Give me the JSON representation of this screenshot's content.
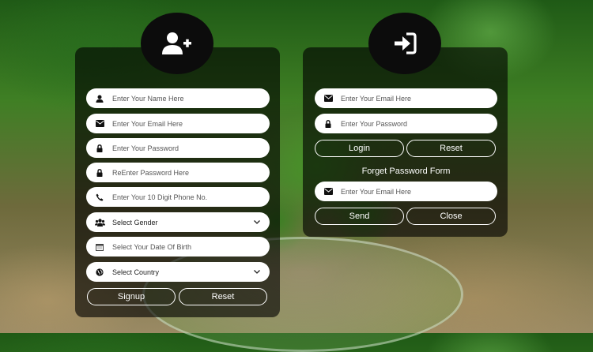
{
  "signup": {
    "name_placeholder": "Enter Your Name Here",
    "email_placeholder": "Enter Your Email Here",
    "password_placeholder": "Enter Your Password",
    "reenter_password_placeholder": "ReEnter Password Here",
    "phone_placeholder": "Enter Your 10 Digit Phone No.",
    "gender_select": "Select Gender",
    "dob_placeholder": "Select Your Date Of Birth",
    "country_select": "Select Country",
    "signup_label": "Signup",
    "reset_label": "Reset"
  },
  "login": {
    "email_placeholder": "Enter Your Email Here",
    "password_placeholder": "Enter Your Password",
    "login_label": "Login",
    "reset_label": "Reset"
  },
  "forget": {
    "title": "Forget Password Form",
    "email_placeholder": "Enter Your Email Here",
    "send_label": "Send",
    "close_label": "Close"
  },
  "icons": {
    "signup_header": "add-user-icon",
    "login_header": "sign-in-icon",
    "name": "user-icon",
    "email": "envelope-icon",
    "password": "lock-icon",
    "phone": "phone-icon",
    "gender": "users-icon",
    "dob": "calendar-icon",
    "country": "globe-icon",
    "dropdown": "chevron-down-icon"
  },
  "colors": {
    "panel": "#000000",
    "field": "#ffffff",
    "button_border": "#ffffff"
  }
}
